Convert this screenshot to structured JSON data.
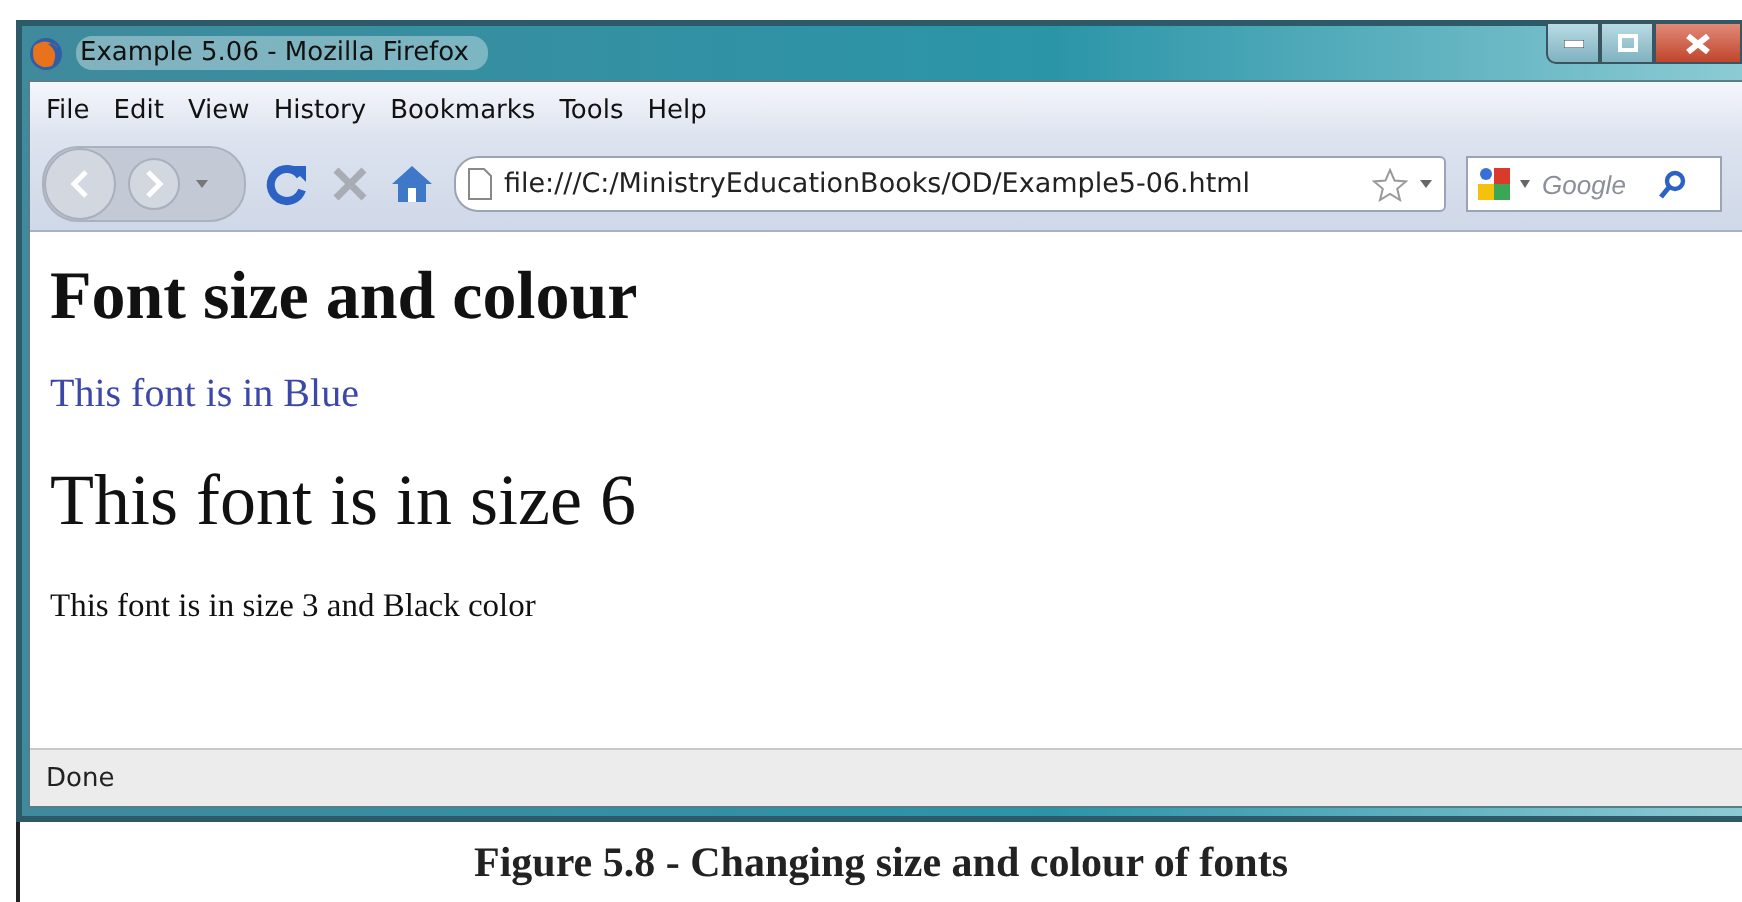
{
  "window": {
    "title": "Example 5.06 - Mozilla Firefox"
  },
  "menu": [
    "File",
    "Edit",
    "View",
    "History",
    "Bookmarks",
    "Tools",
    "Help"
  ],
  "address": {
    "value": "file:///C:/MinistryEducationBooks/OD/Example5-06.html"
  },
  "search": {
    "placeholder": "Google"
  },
  "content": [
    {
      "kind": "heading",
      "text": "Font size and colour"
    },
    {
      "kind": "medium",
      "text": "This font is in Blue",
      "color": "#3b48a8"
    },
    {
      "kind": "large",
      "text": "This font is in size 6",
      "color": "#111111"
    },
    {
      "kind": "small",
      "text": "This font is in size 3 and Black color",
      "color": "#111111"
    }
  ],
  "status_bar": "Done",
  "caption": "Figure 5.8 - Changing size and colour of fonts"
}
